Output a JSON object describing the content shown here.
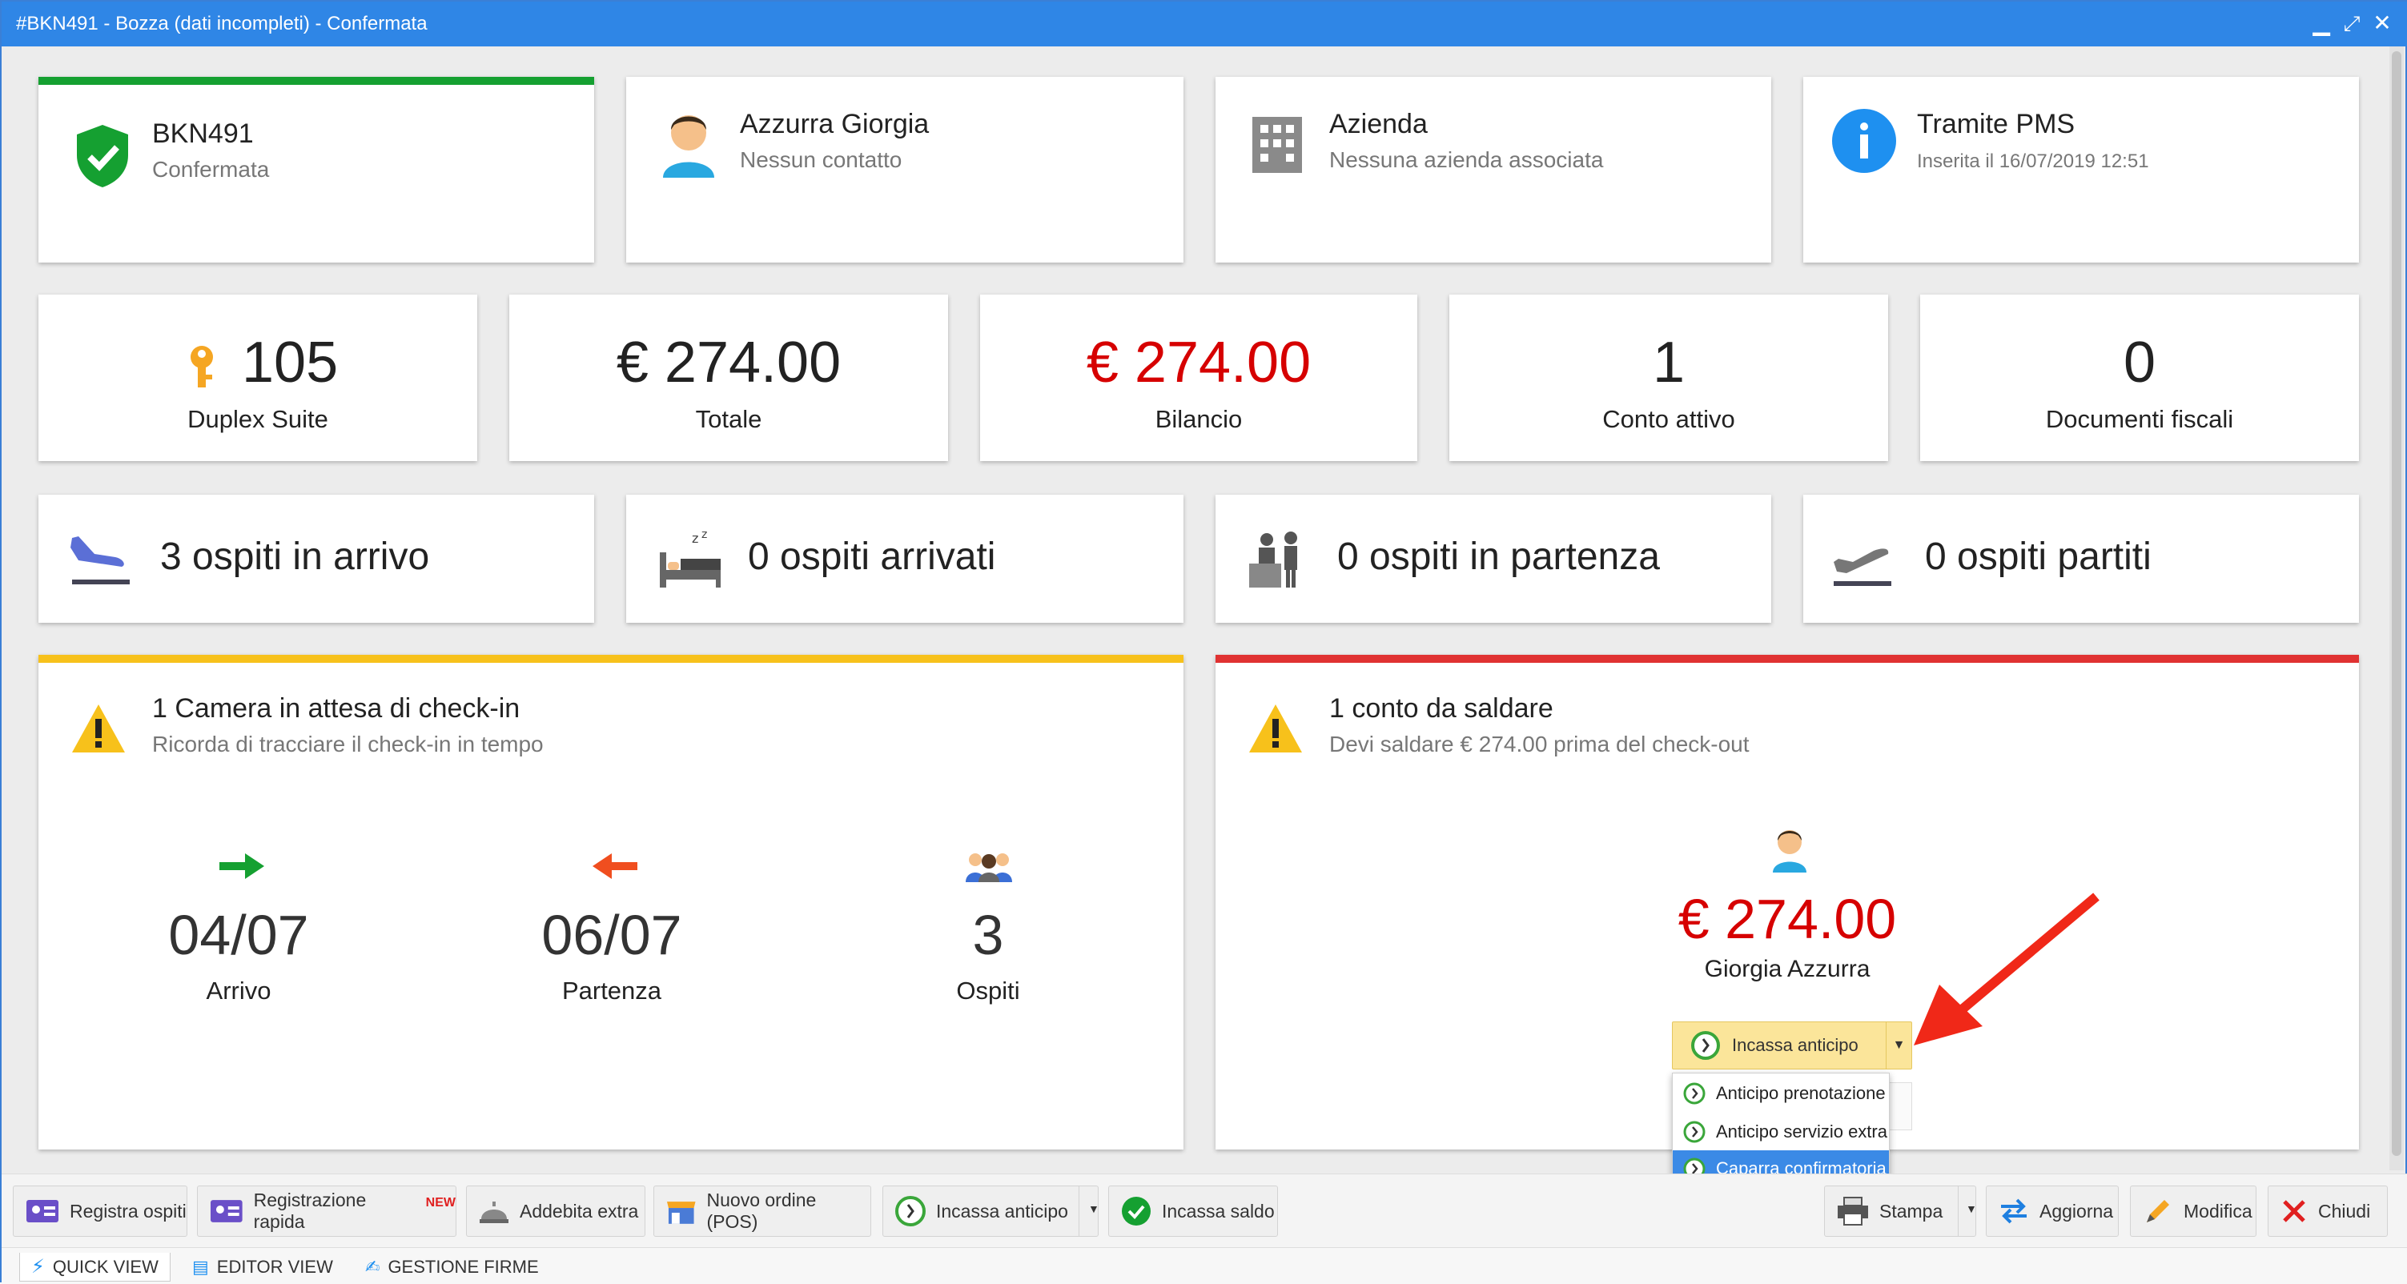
{
  "window": {
    "title": "#BKN491 - Bozza (dati incompleti) - Confermata"
  },
  "header_cards": [
    {
      "title": "BKN491",
      "subtitle": "Confermata"
    },
    {
      "title": "Azzurra Giorgia",
      "subtitle": "Nessun contatto"
    },
    {
      "title": "Azienda",
      "subtitle": "Nessuna azienda associata"
    },
    {
      "title": "Tramite PMS",
      "subtitle": "Inserita il 16/07/2019 12:51"
    }
  ],
  "stats": [
    {
      "value": "105",
      "label": "Duplex Suite"
    },
    {
      "value": "€ 274.00",
      "label": "Totale"
    },
    {
      "value": "€ 274.00",
      "label": "Bilancio"
    },
    {
      "value": "1",
      "label": "Conto attivo"
    },
    {
      "value": "0",
      "label": "Documenti fiscali"
    }
  ],
  "guests": [
    {
      "text": "3 ospiti in arrivo"
    },
    {
      "text": "0 ospiti arrivati"
    },
    {
      "text": "0 ospiti in partenza"
    },
    {
      "text": "0 ospiti partiti"
    }
  ],
  "checkin": {
    "title": "1 Camera in attesa di check-in",
    "subtitle": "Ricorda di tracciare il check-in in tempo",
    "arrival_value": "04/07",
    "arrival_label": "Arrivo",
    "departure_value": "06/07",
    "departure_label": "Partenza",
    "guests_value": "3",
    "guests_label": "Ospiti"
  },
  "account": {
    "title": "1 conto da saldare",
    "subtitle": "Devi saldare € 274.00 prima del check-out",
    "amount": "€ 274.00",
    "name": "Giorgia Azzurra",
    "button": "Incassa anticipo"
  },
  "dropdown": {
    "items": [
      "Anticipo prenotazione",
      "Anticipo servizio extra",
      "Caparra confirmatoria"
    ],
    "selected": "Caparra confirmatoria"
  },
  "toolbar": {
    "registra": "Registra ospiti",
    "rapida": "Registrazione rapida",
    "new_badge": "NEW",
    "addebita": "Addebita extra",
    "ordine": "Nuovo ordine (POS)",
    "anticipo": "Incassa anticipo",
    "saldo": "Incassa saldo",
    "stampa": "Stampa",
    "aggiorna": "Aggiorna",
    "modifica": "Modifica",
    "chiudi": "Chiudi"
  },
  "tabs": [
    "QUICK VIEW",
    "EDITOR VIEW",
    "GESTIONE FIRME"
  ],
  "colors": {
    "accent": "#2f86e6",
    "green": "#15a031",
    "warning": "#f7c11b",
    "danger": "#e03232",
    "amount_red": "#d60000"
  }
}
